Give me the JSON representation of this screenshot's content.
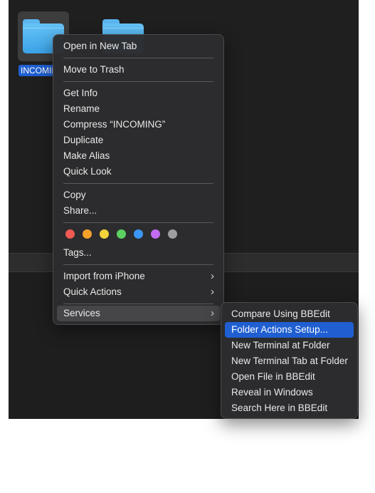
{
  "finder": {
    "selected_folder_label": "INCOMING"
  },
  "context_menu": {
    "items": [
      {
        "label": "Open in New Tab"
      },
      {
        "label": "Move to Trash"
      },
      {
        "label": "Get Info"
      },
      {
        "label": "Rename"
      },
      {
        "label": "Compress “INCOMING”"
      },
      {
        "label": "Duplicate"
      },
      {
        "label": "Make Alias"
      },
      {
        "label": "Quick Look"
      },
      {
        "label": "Copy"
      },
      {
        "label": "Share..."
      },
      {
        "label": "Tags..."
      },
      {
        "label": "Import from iPhone",
        "submenu": true
      },
      {
        "label": "Quick Actions",
        "submenu": true
      },
      {
        "label": "Services",
        "submenu": true,
        "highlighted": true
      }
    ],
    "tag_colors": [
      "#f05a52",
      "#f6a12b",
      "#f4d33b",
      "#5dd160",
      "#3b96f5",
      "#c16cf2",
      "#9e9ea0"
    ],
    "chevron": "›"
  },
  "services_submenu": {
    "items": [
      {
        "label": "Compare Using BBEdit"
      },
      {
        "label": "Folder Actions Setup...",
        "highlighted": true
      },
      {
        "label": "New Terminal at Folder"
      },
      {
        "label": "New Terminal Tab at Folder"
      },
      {
        "label": "Open File in BBEdit"
      },
      {
        "label": "Reveal in Windows"
      },
      {
        "label": "Search Here in BBEdit"
      }
    ]
  },
  "colors": {
    "highlight_blue": "#1f5fd1",
    "menu_bg": "#2c2c2e",
    "folder_blue": "#4fb2f0"
  }
}
